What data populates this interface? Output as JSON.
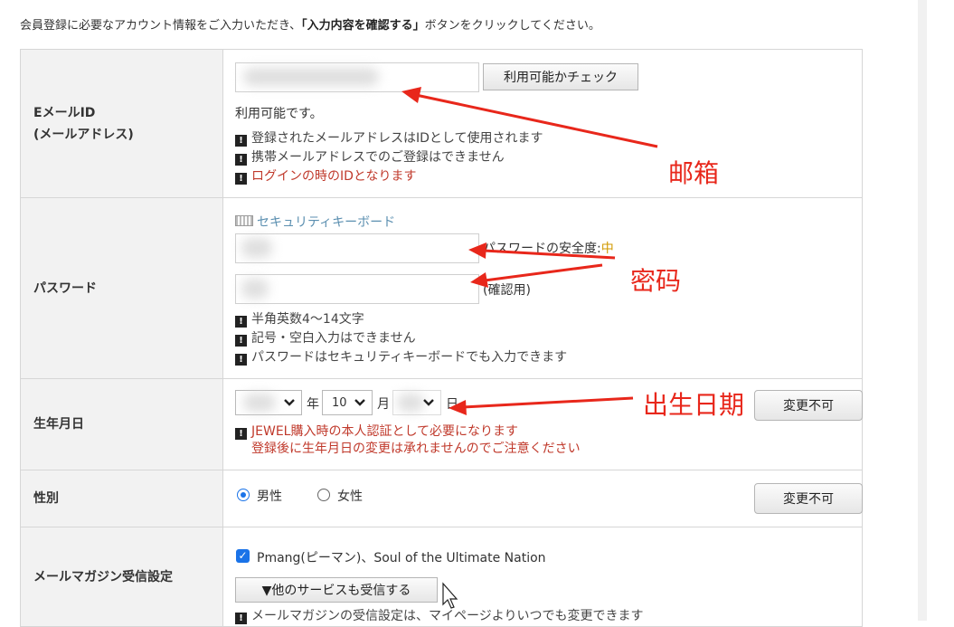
{
  "intro": {
    "before": "会員登録に必要なアカウント情報をご入力いただき、",
    "bold": "「入力内容を確認する」",
    "after": "ボタンをクリックしてください。"
  },
  "email": {
    "label_line1": "EメールID",
    "label_line2": "(メールアドレス)",
    "check_button": "利用可能かチェック",
    "status": "利用可能です。",
    "notes": [
      "登録されたメールアドレスはIDとして使用されます",
      "携帯メールアドレスでのご登録はできません",
      "ログインの時のIDとなります"
    ]
  },
  "password": {
    "label": "パスワード",
    "keyboard_link": "セキュリティキーボード",
    "strength_label": "パスワードの安全度:",
    "strength_value": "中",
    "confirm_label": "(確認用)",
    "notes": [
      "半角英数4～14文字",
      "記号・空白入力はできません",
      "パスワードはセキュリティキーボードでも入力できます"
    ]
  },
  "birth": {
    "label": "生年月日",
    "year_unit": "年",
    "month_value": "10",
    "month_unit": "月",
    "day_unit": "日",
    "change_button": "変更不可",
    "note_line1": "JEWEL購入時の本人認証として必要になります",
    "note_line2": "登録後に生年月日の変更は承れませんのでご注意ください"
  },
  "gender": {
    "label": "性別",
    "male": "男性",
    "female": "女性",
    "selected": "male",
    "change_button": "変更不可"
  },
  "mail": {
    "label": "メールマガジン受信設定",
    "option": "Pmang(ピーマン)、Soul of the Ultimate Nation",
    "more_button": "▼他のサービスも受信する",
    "note_partial": "メールマガジンの受信設定は、マイページよりいつでも変更できます"
  },
  "annotations": {
    "email": "邮箱",
    "password": "密码",
    "birth": "出生日期",
    "color": "#e8271b"
  },
  "colors": {
    "accent": "#1a73e8",
    "warning_text": "#c0392b",
    "link": "#5b8fb0",
    "strength_mid": "#d19a00"
  }
}
